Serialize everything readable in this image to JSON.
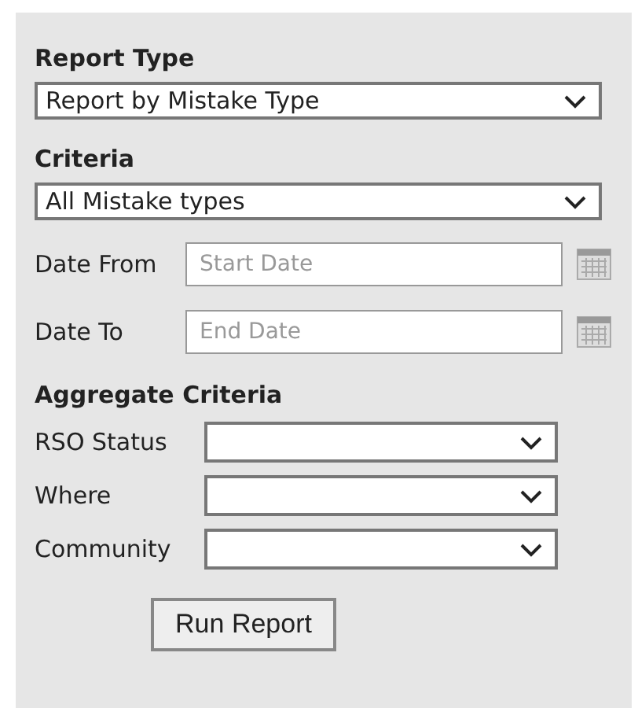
{
  "report_type": {
    "heading": "Report Type",
    "value": "Report by Mistake Type"
  },
  "criteria": {
    "heading": "Criteria",
    "value": "All Mistake types"
  },
  "dates": [
    {
      "label": "Date From",
      "placeholder": "Start Date"
    },
    {
      "label": "Date To",
      "placeholder": "End Date"
    }
  ],
  "aggregate": {
    "heading": "Aggregate Criteria",
    "fields": [
      {
        "label": "RSO Status"
      },
      {
        "label": "Where"
      },
      {
        "label": "Community"
      }
    ]
  },
  "button": "Run Report"
}
